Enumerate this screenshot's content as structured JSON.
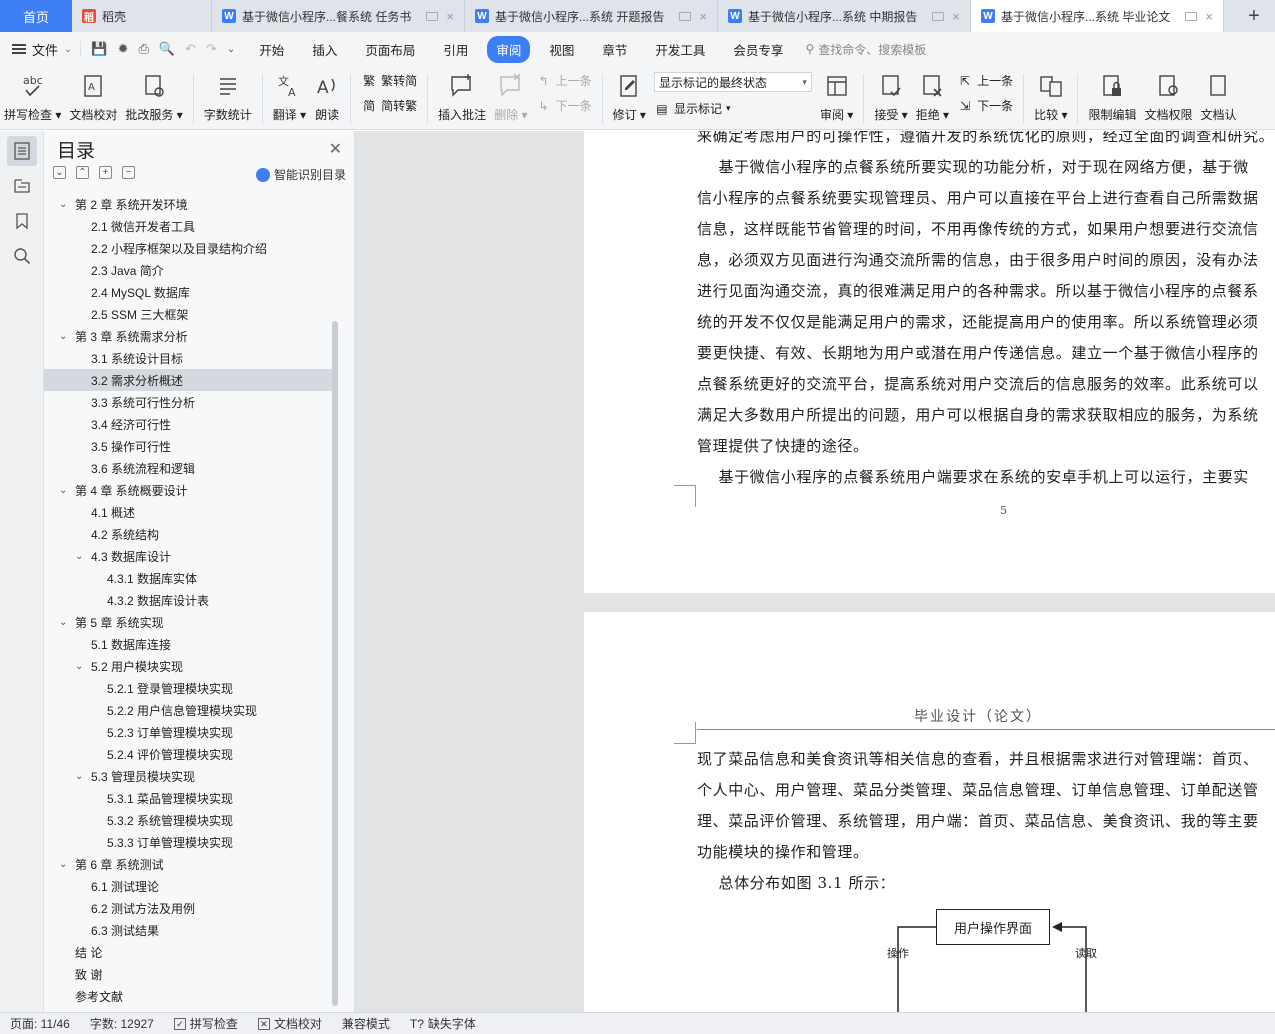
{
  "tabs": {
    "home": "首页",
    "items": [
      {
        "label": "稻壳",
        "icon": "daoke-icon",
        "color": "#e74c3c"
      },
      {
        "label": "基于微信小程序...餐系统 任务书",
        "icon": "wps-writer-icon",
        "color": "#3d7ef5"
      },
      {
        "label": "基于微信小程序...系统 开题报告",
        "icon": "wps-writer-icon",
        "color": "#3d7ef5"
      },
      {
        "label": "基于微信小程序...系统 中期报告",
        "icon": "wps-writer-icon",
        "color": "#3d7ef5"
      },
      {
        "label": "基于微信小程序...系统 毕业论文",
        "icon": "wps-writer-icon",
        "color": "#3d7ef5"
      }
    ],
    "add": "+"
  },
  "menubar": {
    "file": "文件",
    "items": [
      "开始",
      "插入",
      "页面布局",
      "引用",
      "审阅",
      "视图",
      "章节",
      "开发工具",
      "会员专享"
    ],
    "active": "审阅",
    "search": "查找命令、搜索模板"
  },
  "ribbon": {
    "spellcheck": "拼写检查",
    "proofread": "文档校对",
    "revision_service": "批改服务",
    "word_count": "字数统计",
    "translate": "翻译",
    "read_aloud": "朗读",
    "to_simplified": "繁转简",
    "to_traditional": "简转繁",
    "insert_comment": "插入批注",
    "delete": "删除",
    "prev_comment": "上一条",
    "next_comment": "下一条",
    "track_changes": "修订",
    "markup_select": "显示标记的最终状态",
    "show_markup": "显示标记",
    "review": "审阅",
    "accept": "接受",
    "reject": "拒绝",
    "prev_change": "上一条",
    "next_change": "下一条",
    "compare": "比较",
    "restrict_edit": "限制编辑",
    "doc_permission": "文档权限",
    "doc_cut": "文档认"
  },
  "toc": {
    "title": "目录",
    "smart": "智能识别目录",
    "items": [
      {
        "label": "第 2 章    系统开发环境",
        "level": 1,
        "chev": true
      },
      {
        "label": "2.1  微信开发者工具",
        "level": 2
      },
      {
        "label": "2.2 小程序框架以及目录结构介绍",
        "level": 2
      },
      {
        "label": "2.3 Java 简介",
        "level": 2
      },
      {
        "label": "2.4 MySQL 数据库",
        "level": 2
      },
      {
        "label": "2.5 SSM 三大框架",
        "level": 2
      },
      {
        "label": "第 3 章    系统需求分析",
        "level": 1,
        "chev": true
      },
      {
        "label": "3.1  系统设计目标",
        "level": 2
      },
      {
        "label": "3.2 需求分析概述",
        "level": 2,
        "selected": true
      },
      {
        "label": "3.3  系统可行性分析",
        "level": 2
      },
      {
        "label": "3.4 经济可行性",
        "level": 2
      },
      {
        "label": "3.5 操作可行性",
        "level": 2
      },
      {
        "label": "3.6 系统流程和逻辑",
        "level": 2
      },
      {
        "label": "第 4 章    系统概要设计",
        "level": 1,
        "chev": true
      },
      {
        "label": "4.1  概述",
        "level": 2
      },
      {
        "label": "4.2  系统结构",
        "level": 2
      },
      {
        "label": "4.3  数据库设计",
        "level": 2,
        "chev": true
      },
      {
        "label": "4.3.1  数据库实体",
        "level": 3
      },
      {
        "label": "4.3.2  数据库设计表",
        "level": 3
      },
      {
        "label": "第 5 章    系统实现",
        "level": 1,
        "chev": true
      },
      {
        "label": "5.1 数据库连接",
        "level": 2
      },
      {
        "label": "5.2 用户模块实现",
        "level": 2,
        "chev": true
      },
      {
        "label": "5.2.1  登录管理模块实现",
        "level": 3
      },
      {
        "label": "5.2.2  用户信息管理模块实现",
        "level": 3
      },
      {
        "label": "5.2.3  订单管理模块实现",
        "level": 3
      },
      {
        "label": "5.2.4  评价管理模块实现",
        "level": 3
      },
      {
        "label": "5.3  管理员模块实现",
        "level": 2,
        "chev": true
      },
      {
        "label": "5.3.1  菜品管理模块实现",
        "level": 3
      },
      {
        "label": "5.3.2  系统管理模块实现",
        "level": 3
      },
      {
        "label": "5.3.3  订单管理模块实现",
        "level": 3
      },
      {
        "label": "第 6 章    系统测试",
        "level": 1,
        "chev": true
      },
      {
        "label": "6.1  测试理论",
        "level": 2
      },
      {
        "label": "6.2  测试方法及用例",
        "level": 2
      },
      {
        "label": "6.3 测试结果",
        "level": 2
      },
      {
        "label": "结    论",
        "level": 1
      },
      {
        "label": "致    谢",
        "level": 1
      },
      {
        "label": "参考文献",
        "level": 1
      }
    ]
  },
  "document": {
    "page1_lines": [
      "来确定考虑用户的可操作性，遵循开发的系统优化的原则，经过全面的调查和研究。",
      "    基于微信小程序的点餐系统所要实现的功能分析，对于现在网络方便，基于微",
      "信小程序的点餐系统要实现管理员、用户可以直接在平台上进行查看自己所需数据",
      "信息，这样既能节省管理的时间，不用再像传统的方式，如果用户想要进行交流信",
      "息，必须双方见面进行沟通交流所需的信息，由于很多用户时间的原因，没有办法",
      "进行见面沟通交流，真的很难满足用户的各种需求。所以基于微信小程序的点餐系",
      "统的开发不仅仅是能满足用户的需求，还能提高用户的使用率。所以系统管理必须",
      "要更快捷、有效、长期地为用户或潜在用户传递信息。建立一个基于微信小程序的",
      "点餐系统更好的交流平台，提高系统对用户交流后的信息服务的效率。此系统可以",
      "满足大多数用户所提出的问题，用户可以根据自身的需求获取相应的服务，为系统",
      "管理提供了快捷的途径。",
      "    基于微信小程序的点餐系统用户端要求在系统的安卓手机上可以运行，主要实"
    ],
    "page_number": "5",
    "header": "毕业设计（论文）",
    "page2_lines": [
      "现了菜品信息和美食资讯等相关信息的查看，并且根据需求进行对管理端：首页、",
      "个人中心、用户管理、菜品分类管理、菜品信息管理、订单信息管理、订单配送管",
      "理、菜品评价管理、系统管理，用户端：首页、菜品信息、美食资讯、我的等主要",
      "功能模块的操作和管理。",
      "    总体分布如图 3.1 所示："
    ],
    "flow": {
      "box": "用户操作界面",
      "left_label": "操作",
      "right_label": "读取"
    }
  },
  "status": {
    "page": "页面: 11/46",
    "words": "字数: 12927",
    "spellcheck": "拼写检查",
    "proofread": "文档校对",
    "compat": "兼容模式",
    "missing_font": "缺失字体"
  },
  "colors": {
    "accent": "#3d7ef5",
    "tabbar": "#dfe3ea",
    "ribbon": "#f4f5f7",
    "doc_bg": "#e3e4e6"
  }
}
